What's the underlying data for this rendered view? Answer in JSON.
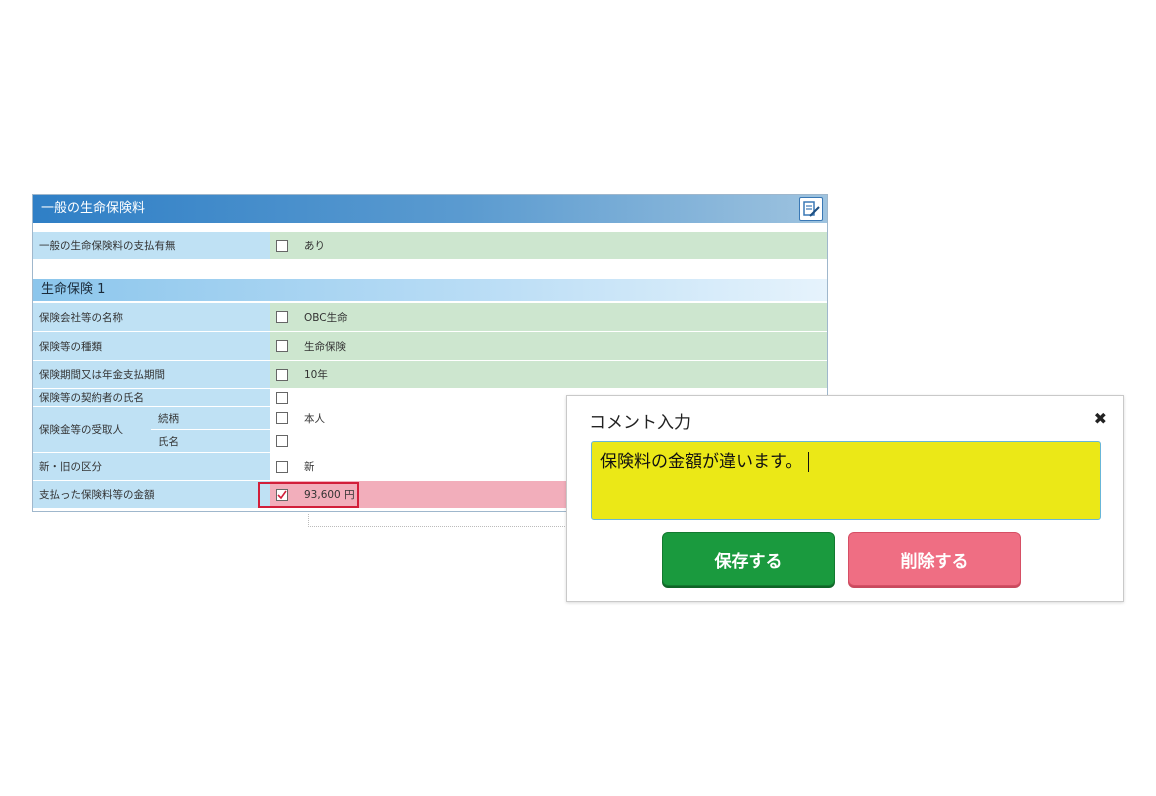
{
  "panel": {
    "title": "一般の生命保険料",
    "edit_icon": "edit-icon",
    "payment_row": {
      "label": "一般の生命保険料の支払有無",
      "value": "あり",
      "checked": false
    }
  },
  "section": {
    "title": "生命保険 1",
    "rows": [
      {
        "label": "保険会社等の名称",
        "value": "OBC生命",
        "checked": false
      },
      {
        "label": "保険等の種類",
        "value": "生命保険",
        "checked": false
      },
      {
        "label": "保険期間又は年金支払期間",
        "value": "10年",
        "checked": false
      },
      {
        "label": "保険等の契約者の氏名",
        "value": "",
        "checked": false
      },
      {
        "label": "保険金等の受取人",
        "sub1": "続柄",
        "sub1_value": "本人",
        "sub2": "氏名",
        "sub2_value": ""
      },
      {
        "label": "新・旧の区分",
        "value": "新",
        "checked": false
      },
      {
        "label": "支払った保険料等の金額",
        "value": "93,600 円",
        "checked": true
      }
    ]
  },
  "dialog": {
    "title": "コメント入力",
    "close_icon": "close-icon",
    "comment": "保険料の金額が違います。",
    "save_label": "保存する",
    "delete_label": "削除する"
  },
  "colors": {
    "header_blue": "#2f7fc6",
    "label_blue": "#bfe1f4",
    "value_green": "#cde6cf",
    "value_pink": "#f2aebb",
    "comment_yellow": "#ebe817",
    "save_green": "#1a9a3e",
    "delete_pink": "#ef6e83"
  }
}
